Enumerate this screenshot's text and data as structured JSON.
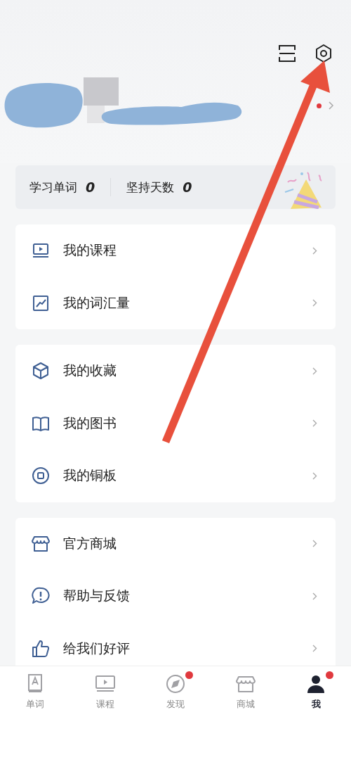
{
  "header": {
    "notification_dot": true
  },
  "stats": [
    {
      "label": "学习单词",
      "value": "0"
    },
    {
      "label": "坚持天数",
      "value": "0"
    }
  ],
  "menu_groups": [
    [
      {
        "kind": "course",
        "label": "我的课程"
      },
      {
        "kind": "vocab",
        "label": "我的词汇量"
      }
    ],
    [
      {
        "kind": "collect",
        "label": "我的收藏"
      },
      {
        "kind": "book",
        "label": "我的图书"
      },
      {
        "kind": "coin",
        "label": "我的铜板"
      }
    ],
    [
      {
        "kind": "shop",
        "label": "官方商城"
      },
      {
        "kind": "help",
        "label": "帮助与反馈"
      },
      {
        "kind": "rate",
        "label": "给我们好评"
      }
    ]
  ],
  "tabs": [
    {
      "kind": "word",
      "label": "单词",
      "selected": false,
      "badge": false
    },
    {
      "kind": "course",
      "label": "课程",
      "selected": false,
      "badge": false
    },
    {
      "kind": "discover",
      "label": "发现",
      "selected": false,
      "badge": true
    },
    {
      "kind": "shop",
      "label": "商城",
      "selected": false,
      "badge": false
    },
    {
      "kind": "me",
      "label": "我",
      "selected": true,
      "badge": true
    }
  ]
}
